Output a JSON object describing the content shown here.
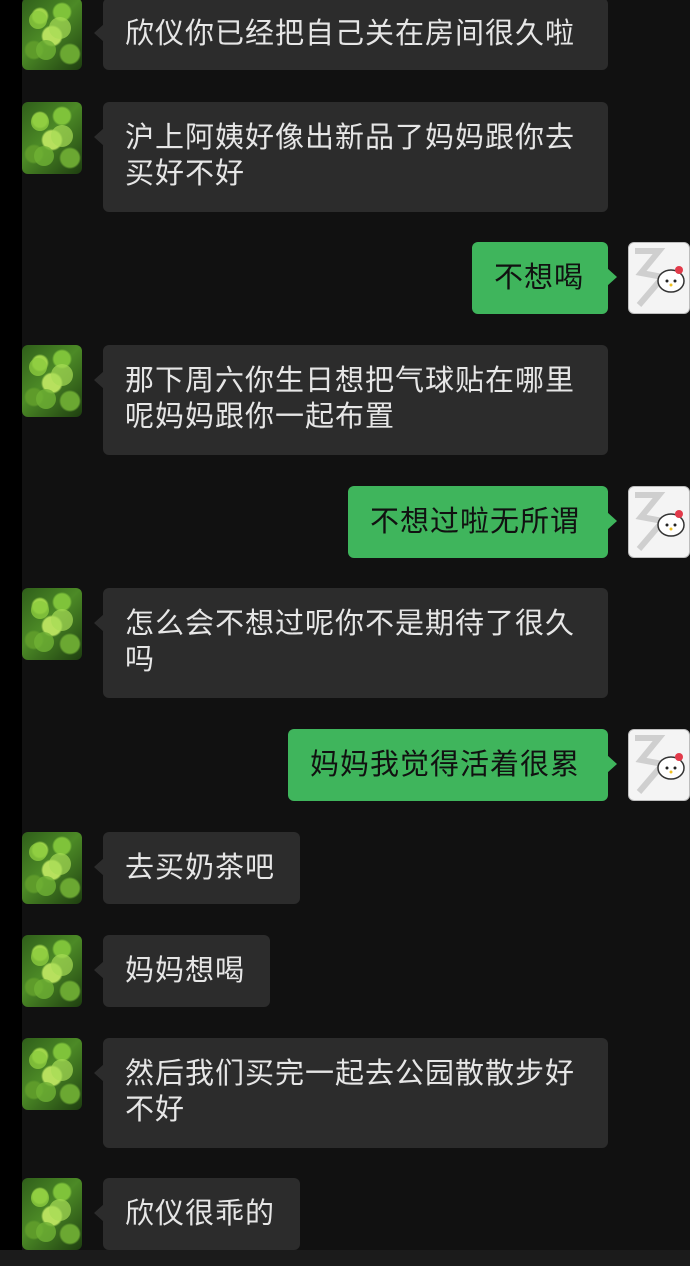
{
  "messages": [
    {
      "sender": "contact",
      "text": "欣仪你已经把自己关在房间很久啦"
    },
    {
      "sender": "contact",
      "text": "沪上阿姨好像出新品了妈妈跟你去买好不好"
    },
    {
      "sender": "me",
      "text": "不想喝"
    },
    {
      "sender": "contact",
      "text": "那下周六你生日想把气球贴在哪里呢妈妈跟你一起布置"
    },
    {
      "sender": "me",
      "text": "不想过啦无所谓"
    },
    {
      "sender": "contact",
      "text": "怎么会不想过呢你不是期待了很久吗"
    },
    {
      "sender": "me",
      "text": "妈妈我觉得活着很累"
    },
    {
      "sender": "contact",
      "text": "去买奶茶吧"
    },
    {
      "sender": "contact",
      "text": "妈妈想喝"
    },
    {
      "sender": "contact",
      "text": "然后我们买完一起去公园散散步好不好"
    },
    {
      "sender": "contact",
      "text": "欣仪很乖的"
    }
  ],
  "avatars": {
    "contact": "clover-leaves-avatar",
    "me": "hello-kitty-avatar"
  },
  "colors": {
    "background": "#111111",
    "contact_bubble": "#2c2c2c",
    "my_bubble": "#3fb55c",
    "contact_text": "#e6e6e6",
    "my_text": "#111111"
  }
}
